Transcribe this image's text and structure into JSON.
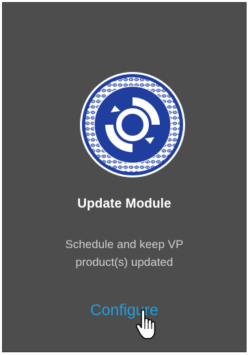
{
  "card": {
    "title": "Update Module",
    "description_line1": "Schedule and keep VP",
    "description_line2": "product(s) updated",
    "configure_label": "Configure"
  },
  "colors": {
    "card_background": "#4d4d4d",
    "link": "#1e9fe0",
    "emblem_blue": "#1f3e9e",
    "title_text": "#ffffff"
  },
  "icons": {
    "emblem": "update-module-emblem-icon",
    "cursor": "hand-pointer-icon"
  }
}
